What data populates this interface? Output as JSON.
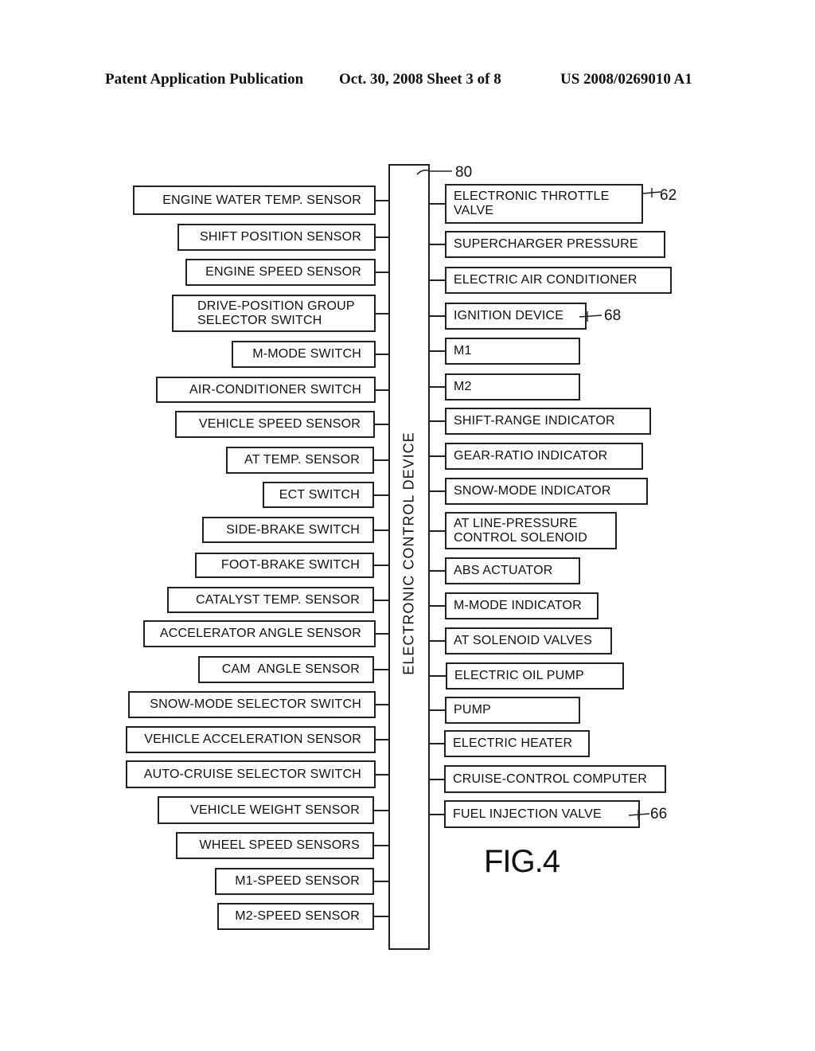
{
  "header": {
    "publication": "Patent Application Publication",
    "date_sheet": "Oct. 30, 2008  Sheet 3 of 8",
    "patent_number": "US 2008/0269010 A1"
  },
  "diagram": {
    "central_block": {
      "label": "ELECTRONIC CONTROL DEVICE",
      "ref": "80"
    },
    "inputs": [
      "ENGINE WATER TEMP. SENSOR",
      "SHIFT POSITION SENSOR",
      "ENGINE SPEED SENSOR",
      "DRIVE-POSITION GROUP\nSELECTOR SWITCH",
      "M-MODE SWITCH",
      "AIR-CONDITIONER SWITCH",
      "VEHICLE SPEED SENSOR",
      "AT TEMP. SENSOR",
      "ECT SWITCH",
      "SIDE-BRAKE SWITCH",
      "FOOT-BRAKE SWITCH",
      "CATALYST TEMP. SENSOR",
      "ACCELERATOR ANGLE SENSOR",
      "CAM  ANGLE SENSOR",
      "SNOW-MODE SELECTOR SWITCH",
      "VEHICLE ACCELERATION SENSOR",
      "AUTO-CRUISE SELECTOR SWITCH",
      "VEHICLE WEIGHT SENSOR",
      "WHEEL SPEED SENSORS",
      "M1-SPEED SENSOR",
      "M2-SPEED SENSOR"
    ],
    "outputs": [
      "ELECTRONIC THROTTLE\nVALVE",
      "SUPERCHARGER PRESSURE",
      "ELECTRIC AIR CONDITIONER",
      "IGNITION DEVICE",
      "M1",
      "M2",
      "SHIFT-RANGE INDICATOR",
      "GEAR-RATIO INDICATOR",
      "SNOW-MODE INDICATOR",
      "AT LINE-PRESSURE\nCONTROL SOLENOID",
      "ABS ACTUATOR",
      "M-MODE INDICATOR",
      "AT SOLENOID VALVES",
      "ELECTRIC OIL PUMP",
      "PUMP",
      "ELECTRIC HEATER",
      "CRUISE-CONTROL COMPUTER",
      "FUEL INJECTION VALVE"
    ],
    "reference_numerals": {
      "electronic_throttle_valve": "62",
      "ignition_device": "68",
      "fuel_injection_valve": "66"
    },
    "figure_label": "FIG.4"
  }
}
